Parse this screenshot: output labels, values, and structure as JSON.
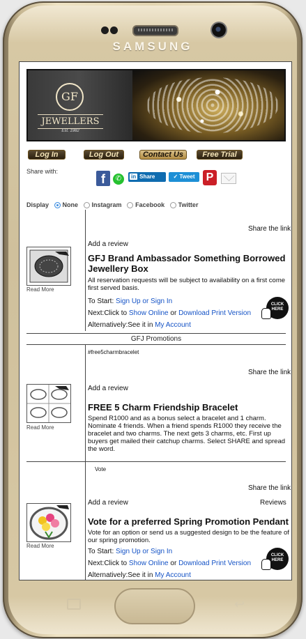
{
  "device": {
    "brand": "SAMSUNG"
  },
  "banner": {
    "logo_letters": "GF",
    "logo_name": "JEWELLERS",
    "logo_est": "Est. 1982"
  },
  "nav_buttons": {
    "login": "Log In",
    "logout": "Log Out",
    "contact": "Contact Us",
    "free_trial": "Free Trial"
  },
  "share": {
    "label": "Share with:",
    "linkedin": "Share",
    "linkedin_in": "in",
    "tweet": "Tweet",
    "facebook": "f",
    "pinterest": "P"
  },
  "display": {
    "label": "Display",
    "options": [
      "None",
      "Instagram",
      "Facebook",
      "Twitter"
    ],
    "selected": "None"
  },
  "common": {
    "share_link": "Share the link",
    "add_review": "Add a review",
    "read_more": "Read More",
    "to_start": "To Start:",
    "sign_up": "Sign Up or Sign In",
    "next_click": "Next:Click to",
    "show_online": "Show Online",
    "or": "or",
    "download": "Download Print Version",
    "alternatively": "Alternatively:See it in",
    "my_account": "My Account",
    "click_here": "CLICK HERE",
    "reviews": "Reviews"
  },
  "promo1": {
    "title": "GFJ Brand Ambassador Something Borrowed Jewellery Box",
    "desc": "All reservation requests will be subject to availability on a first come first served basis."
  },
  "section": {
    "title": "GFJ Promotions"
  },
  "promo2": {
    "hashtag": "#free5charmbracelet",
    "title": "FREE 5 Charm Friendship Bracelet",
    "desc": "Spend R1000 and as a bonus select a bracelet and 1 charm. Nominate 4 friends. When a friend spends R1000 they receive the bracelet and two charms. The next gets 3 charms, etc. First up buyers get mailed their catchup charms. Select SHARE and spread the word."
  },
  "promo3": {
    "tag": "Vote",
    "title": "Vote for a preferred Spring Promotion Pendant",
    "desc": "Vote for an option or send us a suggested design to be the feature of our spring promotion."
  }
}
